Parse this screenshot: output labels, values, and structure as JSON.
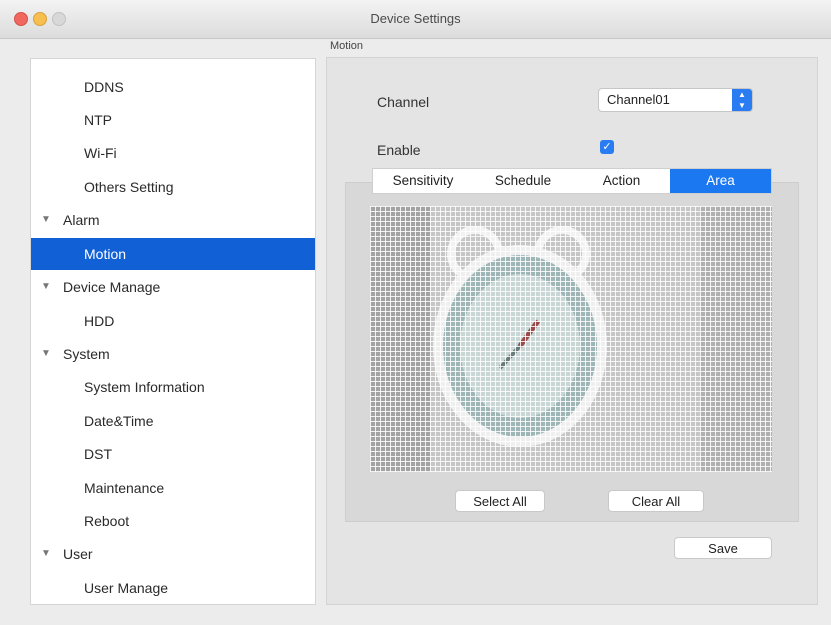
{
  "window": {
    "title": "Device Settings"
  },
  "section_label": "Motion",
  "sidebar": {
    "items": [
      {
        "label": "DDNS",
        "kind": "child"
      },
      {
        "label": "NTP",
        "kind": "child"
      },
      {
        "label": "Wi-Fi",
        "kind": "child"
      },
      {
        "label": "Others Setting",
        "kind": "child"
      },
      {
        "label": "Alarm",
        "kind": "group"
      },
      {
        "label": "Motion",
        "kind": "child",
        "selected": true
      },
      {
        "label": "Device Manage",
        "kind": "group"
      },
      {
        "label": "HDD",
        "kind": "child"
      },
      {
        "label": "System",
        "kind": "group"
      },
      {
        "label": "System Information",
        "kind": "child"
      },
      {
        "label": "Date&Time",
        "kind": "child"
      },
      {
        "label": "DST",
        "kind": "child"
      },
      {
        "label": "Maintenance",
        "kind": "child"
      },
      {
        "label": "Reboot",
        "kind": "child"
      },
      {
        "label": "User",
        "kind": "group"
      },
      {
        "label": "User Manage",
        "kind": "child"
      }
    ]
  },
  "form": {
    "channel_label": "Channel",
    "channel_value": "Channel01",
    "enable_label": "Enable",
    "enable_checked": true
  },
  "tabs": [
    {
      "label": "Sensitivity"
    },
    {
      "label": "Schedule"
    },
    {
      "label": "Action"
    },
    {
      "label": "Area",
      "active": true
    }
  ],
  "buttons": {
    "select_all": "Select All",
    "clear_all": "Clear All",
    "save": "Save"
  },
  "colors": {
    "accent": "#1b78f0",
    "selection": "#1160d6"
  },
  "icons": {
    "close": "close-icon",
    "minimize": "minimize-icon",
    "maximize": "maximize-icon",
    "group_toggle": "disclosure-triangle-icon",
    "dropdown": "chevron-updown-icon",
    "checkbox": "checkmark-icon"
  }
}
